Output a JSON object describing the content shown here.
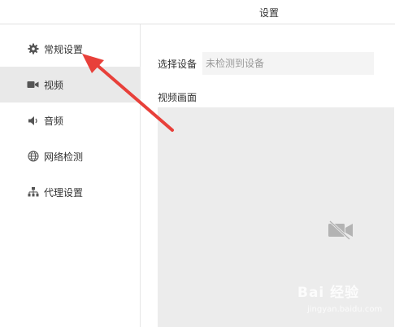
{
  "window": {
    "title": "设置"
  },
  "sidebar": {
    "items": [
      {
        "label": "常规设置",
        "icon": "gear-icon"
      },
      {
        "label": "视频",
        "icon": "camera-icon",
        "active": true
      },
      {
        "label": "音频",
        "icon": "speaker-icon"
      },
      {
        "label": "网络检测",
        "icon": "globe-icon"
      },
      {
        "label": "代理设置",
        "icon": "network-tree-icon"
      }
    ]
  },
  "main": {
    "select_label": "选择设备",
    "select_value": "未检测到设备",
    "video_label": "视频画面",
    "video_placeholder_icon": "video-off-icon"
  },
  "annotation": {
    "arrow_color": "#e8403a"
  },
  "watermark": {
    "text": "Bai 经验",
    "sub": "jingyan.baidu.com"
  }
}
